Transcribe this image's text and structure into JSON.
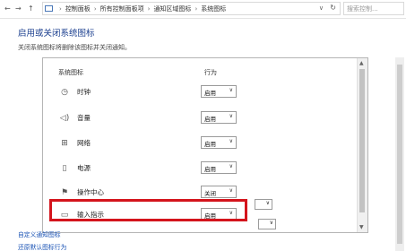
{
  "address_bar": {
    "back_icon": "back-arrow-icon",
    "forward_icon": "forward-arrow-icon",
    "up_icon": "up-arrow-icon",
    "breadcrumbs": [
      "控制面板",
      "所有控制面板项",
      "通知区域图标",
      "系统图标"
    ],
    "search_placeholder": "搜索控制..."
  },
  "page": {
    "title": "启用或关闭系统图标",
    "subtitle": "关闭系统图标将删除该图标并关闭通知。"
  },
  "table": {
    "col_icon": "系统图标",
    "col_behavior": "行为",
    "rows": [
      {
        "icon": "clock-icon",
        "name": "时钟",
        "value": "启用"
      },
      {
        "icon": "volume-icon",
        "name": "音量",
        "value": "启用"
      },
      {
        "icon": "network-icon",
        "name": "网络",
        "value": "启用"
      },
      {
        "icon": "power-icon",
        "name": "电源",
        "value": "启用"
      },
      {
        "icon": "flag-icon",
        "name": "操作中心",
        "value": "关闭"
      },
      {
        "icon": "keyboard-icon",
        "name": "输入指示",
        "value": "启用"
      }
    ]
  },
  "links": {
    "customize": "自定义通知图标",
    "restore": "还原默认图标行为"
  },
  "colors": {
    "title": "#1b3f8f",
    "link": "#1a53b5",
    "highlight": "#d4141c"
  }
}
